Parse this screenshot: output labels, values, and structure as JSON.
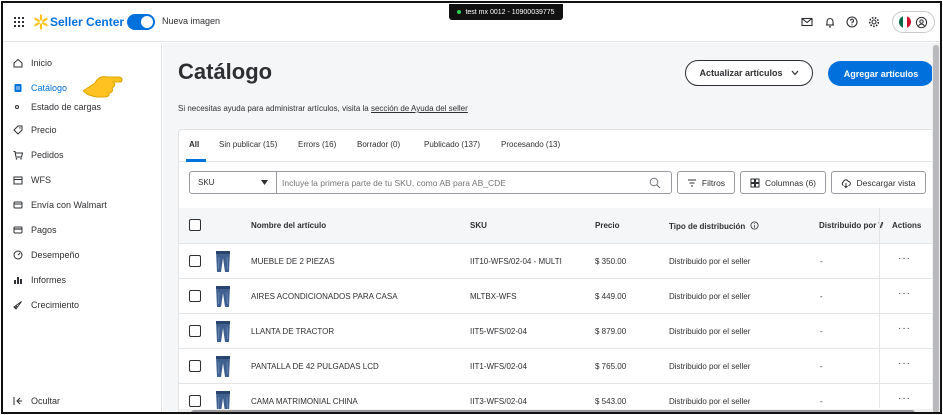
{
  "topbar": {
    "brand": "Seller Center",
    "toggle_label": "Nueva imagen",
    "env_label": "test mx 0012 - 10900039775"
  },
  "sidebar": {
    "items": [
      {
        "label": "Inicio",
        "icon": "home-icon"
      },
      {
        "label": "Catálogo",
        "icon": "catalog-icon",
        "active": true
      },
      {
        "label": "Estado de cargas",
        "icon": "sub-dot-icon"
      },
      {
        "label": "Precio",
        "icon": "tag-icon"
      },
      {
        "label": "Pedidos",
        "icon": "cart-icon"
      },
      {
        "label": "WFS",
        "icon": "box-icon"
      },
      {
        "label": "Envía con Walmart",
        "icon": "truck-icon"
      },
      {
        "label": "Pagos",
        "icon": "card-icon"
      },
      {
        "label": "Desempeño",
        "icon": "gauge-icon"
      },
      {
        "label": "Informes",
        "icon": "chart-icon"
      },
      {
        "label": "Crecimiento",
        "icon": "rocket-icon"
      }
    ],
    "collapse_label": "Ocultar"
  },
  "main": {
    "title": "Catálogo",
    "help_prefix": "Si necesitas ayuda para administrar artículos, visita la ",
    "help_link": "sección de Ayuda del seller",
    "update_button": "Actualizar artículos",
    "add_button": "Agregar artículos"
  },
  "tabs": [
    "All",
    "Sin publicar (15)",
    "Errors (16)",
    "Borrador (0)",
    "Publicado (137)",
    "Procesando (13)"
  ],
  "toolbar": {
    "select_value": "SKU",
    "search_placeholder": "Incluye la primera parte de tu SKU, como AB para AB_CDE",
    "filters": "Filtros",
    "columns": "Columnas (6)",
    "download": "Descargar vista"
  },
  "table": {
    "headers": [
      "Nombre del artículo",
      "SKU",
      "Precio",
      "Tipo de distribución",
      "Distribuido por W",
      "Actions"
    ],
    "rows": [
      {
        "name": "MUEBLE DE 2 PIEZAS",
        "sku": "IIT10-WFS/02-04 - MULTI",
        "price": "$ 350.00",
        "dist": "Distribuido por el seller",
        "by_w": "-"
      },
      {
        "name": "AIRES ACONDICIONADOS PARA CASA",
        "sku": "MLTBX-WFS",
        "price": "$ 449.00",
        "dist": "Distribuido por el seller",
        "by_w": "-"
      },
      {
        "name": "LLANTA DE TRACTOR",
        "sku": "IIT5-WFS/02-04",
        "price": "$ 879.00",
        "dist": "Distribuido por el seller",
        "by_w": "-"
      },
      {
        "name": "PANTALLA DE 42 PULGADAS LCD",
        "sku": "IIT1-WFS/02-04",
        "price": "$ 765.00",
        "dist": "Distribuido por el seller",
        "by_w": "-"
      },
      {
        "name": "CAMA MATRIMONIAL CHINA",
        "sku": "IIT3-WFS/02-04",
        "price": "$ 543.00",
        "dist": "Distribuido por el seller",
        "by_w": "-"
      }
    ]
  },
  "colors": {
    "accent": "#0071dc",
    "brand_spark": "#ffc220",
    "text": "#2e2f32"
  }
}
